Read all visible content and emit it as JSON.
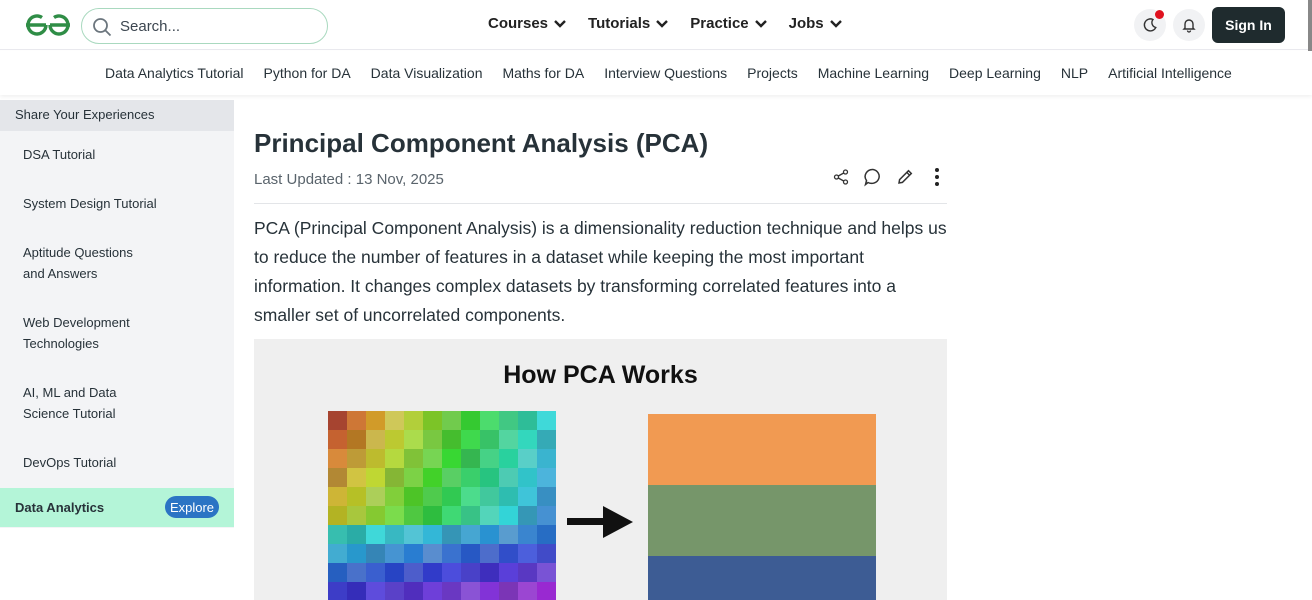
{
  "header": {
    "search_placeholder": "Search...",
    "nav": [
      "Courses",
      "Tutorials",
      "Practice",
      "Jobs"
    ],
    "sign_in": "Sign In"
  },
  "subnav": [
    "Data Analytics Tutorial",
    "Python for DA",
    "Data Visualization",
    "Maths for DA",
    "Interview Questions",
    "Projects",
    "Machine Learning",
    "Deep Learning",
    "NLP",
    "Artificial Intelligence"
  ],
  "sidebar": {
    "heading": "Share Your Experiences",
    "items": [
      "DSA Tutorial",
      "System Design Tutorial",
      "Aptitude Questions and Answers",
      "Web Development Technologies",
      "AI, ML and Data Science Tutorial",
      "DevOps Tutorial"
    ],
    "active": "Data Analytics",
    "explore": "Explore"
  },
  "article": {
    "title": "Principal Component Analysis (PCA)",
    "updated": "Last Updated : 13 Nov, 2025",
    "paragraph": "PCA (Principal Component Analysis) is a dimensionality reduction technique and helps us to reduce the number of features in a dataset while keeping the most important information. It changes complex datasets by transforming correlated features into a smaller set of uncorrelated components.",
    "figure_title": "How PCA Works"
  },
  "colors": {
    "brand_green": "#2f8d46",
    "bar_colors": [
      "#f19a52",
      "#76966a",
      "#3d5c94"
    ]
  }
}
